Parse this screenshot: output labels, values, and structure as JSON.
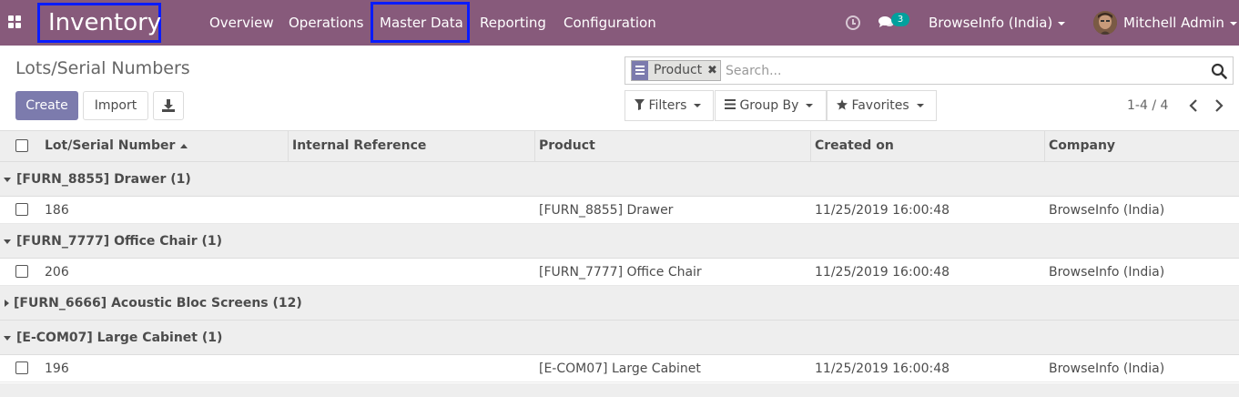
{
  "navbar": {
    "app_name": "Inventory",
    "menu": [
      "Overview",
      "Operations",
      "Master Data",
      "Reporting",
      "Configuration"
    ],
    "chat_count": "3",
    "company": "BrowseInfo (India)",
    "user": "Mitchell Admin",
    "colors": {
      "bar": "#875a7b",
      "highlight_border": "#0a1cff",
      "badge": "#00a09d"
    }
  },
  "control_panel": {
    "title": "Lots/Serial Numbers",
    "create_label": "Create",
    "import_label": "Import",
    "search": {
      "facet_label": "Product",
      "placeholder": "Search..."
    },
    "filters_label": "Filters",
    "groupby_label": "Group By",
    "favorites_label": "Favorites",
    "pager": "1-4 / 4"
  },
  "table": {
    "columns": [
      "Lot/Serial Number",
      "Internal Reference",
      "Product",
      "Created on",
      "Company"
    ],
    "groups": [
      {
        "label": "[FURN_8855] Drawer (1)",
        "expanded": true,
        "rows": [
          {
            "lot": "186",
            "ref": "",
            "product": "[FURN_8855] Drawer",
            "created": "11/25/2019 16:00:48",
            "company": "BrowseInfo (India)"
          }
        ]
      },
      {
        "label": "[FURN_7777] Office Chair (1)",
        "expanded": true,
        "rows": [
          {
            "lot": "206",
            "ref": "",
            "product": "[FURN_7777] Office Chair",
            "created": "11/25/2019 16:00:48",
            "company": "BrowseInfo (India)"
          }
        ]
      },
      {
        "label": "[FURN_6666] Acoustic Bloc Screens (12)",
        "expanded": false,
        "rows": []
      },
      {
        "label": "[E-COM07] Large Cabinet (1)",
        "expanded": true,
        "rows": [
          {
            "lot": "196",
            "ref": "",
            "product": "[E-COM07] Large Cabinet",
            "created": "11/25/2019 16:00:48",
            "company": "BrowseInfo (India)"
          }
        ]
      }
    ]
  }
}
